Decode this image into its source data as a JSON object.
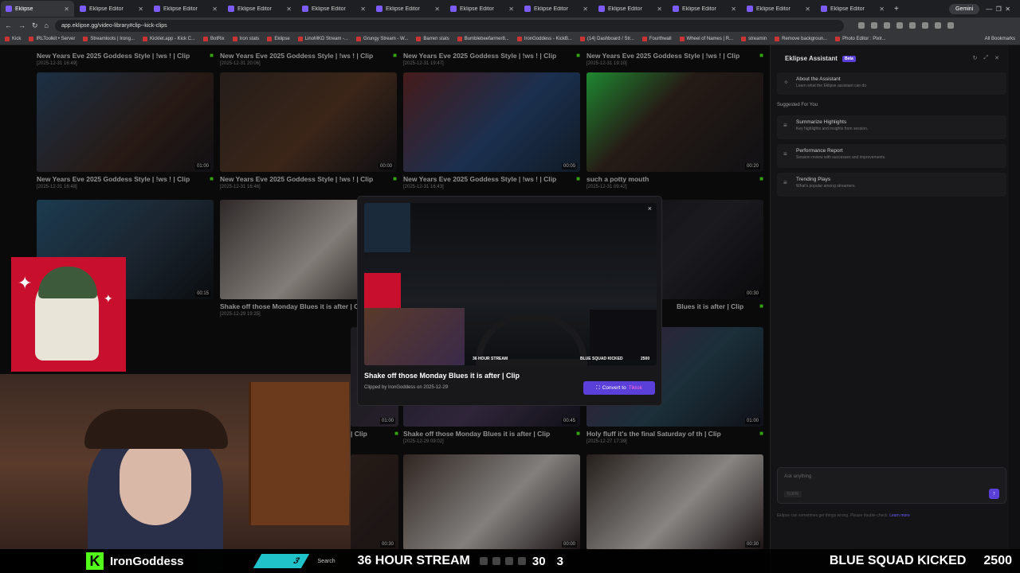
{
  "browser": {
    "tabs": [
      {
        "label": "Eklipse"
      },
      {
        "label": "Eklipse Editor"
      },
      {
        "label": "Eklipse Editor"
      },
      {
        "label": "Eklipse Editor"
      },
      {
        "label": "Eklipse Editor"
      },
      {
        "label": "Eklipse Editor"
      },
      {
        "label": "Eklipse Editor"
      },
      {
        "label": "Eklipse Editor"
      },
      {
        "label": "Eklipse Editor"
      },
      {
        "label": "Eklipse Editor"
      },
      {
        "label": "Eklipse Editor"
      },
      {
        "label": "Eklipse Editor"
      }
    ],
    "new_tab": "+",
    "gemini_label": "Gemini",
    "url": "app.eklipse.gg/video-library#clip--kick-clips",
    "bookmarks": [
      "Kick",
      "IRLToolkit • Server",
      "Streamloots | Irong...",
      "Kicklet.app - Kick C...",
      "BotRix",
      "Iron stats",
      "Eklipse",
      "LinoMKD Stream -...",
      "Grungy Stream - W...",
      "Barren stats",
      "Bumblebeefarmer8...",
      "IronGoddess - KickB...",
      "(14) Dashboard / Str...",
      "Fourthwall",
      "Wheel of Names | R...",
      "streamin",
      "Remove backgroun...",
      "Photo Editor : Pixlr..."
    ],
    "all_bookmarks": "All Bookmarks"
  },
  "clips": {
    "row1_titles": [
      {
        "title": "New Years Eve 2025 Goddess Style | !ws ! | Clip",
        "date": "[2025-12-31 16:49]"
      },
      {
        "title": "New Years Eve 2025 Goddess Style | !ws ! | Clip",
        "date": "[2025-12-31 20:06]"
      },
      {
        "title": "New Years Eve 2025 Goddess Style | !ws ! | Clip",
        "date": "[2025-12-31 19:47]"
      },
      {
        "title": "New Years Eve 2025 Goddess Style | !ws ! | Clip",
        "date": "[2025-12-31 19:10]"
      }
    ],
    "row2": [
      {
        "title": "New Years Eve 2025 Goddess Style | !ws ! | Clip",
        "date": "[2025-12-31 16:48]",
        "duration": "01:00"
      },
      {
        "title": "New Years Eve 2025 Goddess Style | !ws ! | Clip",
        "date": "[2025-12-31 16:46]",
        "duration": "00:00"
      },
      {
        "title": "New Years Eve 2025 Goddess Style | !ws ! | Clip",
        "date": "[2025-12-31 16:43]",
        "duration": "00:00"
      },
      {
        "title": "such a potty mouth",
        "date": "[2025-12-31 09:42]",
        "duration": "00:20"
      }
    ],
    "row3": [
      {
        "title": "",
        "date": "",
        "duration": "00:15"
      },
      {
        "title": "Shake off those Monday Blues it is after | C",
        "date": "[2025-12-29 19:25]",
        "duration": ""
      },
      {
        "title": "",
        "date": "",
        "duration": ""
      },
      {
        "title": "Blues it is after | Clip",
        "date": "",
        "duration": "00:30"
      }
    ],
    "row4": [
      {
        "title": "| Clip",
        "date": "",
        "duration": "01:00"
      },
      {
        "title": "Shake off those Monday Blues it is after | Clip",
        "date": "[2025-12-29 09:02]",
        "duration": "00:45"
      },
      {
        "title": "Holy fluff it's the final Saturday of th | Clip",
        "date": "[2025-12-27 17:39]",
        "duration": "01:00"
      }
    ],
    "row5_durations": [
      "00:30",
      "00:00",
      "00:30"
    ]
  },
  "modal": {
    "close": "×",
    "title": "Shake off those Monday Blues it is after | Clip",
    "clipped_by": "Clipped by IronGoddess on 2025-12-29",
    "convert_label": "Convert to",
    "convert_target": "Tiktok",
    "overlay_stream": "36 HOUR STREAM",
    "overlay_blue": "BLUE SQUAD KICKED",
    "overlay_num": "2500"
  },
  "assistant": {
    "title": "Eklipse Assistant",
    "badge": "Beta",
    "about_title": "About the Assistant",
    "about_sub": "Learn what the Eklipse assistant can do",
    "suggested": "Suggested For You",
    "items": [
      {
        "title": "Summarize Highlights",
        "sub": "Key highlights and insights from session."
      },
      {
        "title": "Performance Report",
        "sub": "Session review with successes and improvements."
      },
      {
        "title": "Trending Plays",
        "sub": "What's popular among streamers."
      }
    ],
    "ask_placeholder": "Ask anything",
    "credits": "0.00%",
    "disclaimer": "Eklipse can sometimes get things wrong. Please double-check.",
    "learn_more": "Learn more"
  },
  "stream_overlay": {
    "username": "IronGoddess",
    "kick_logo": "K",
    "teal_count": "3",
    "search": "Search",
    "hour_stream": "36 HOUR STREAM",
    "count_30": "30",
    "count_3": "3",
    "blue_squad": "BLUE SQUAD KICKED",
    "goal": "2500"
  },
  "colors": {
    "accent": "#5b3fd9",
    "kick_green": "#53fc18",
    "teal": "#20c3c9",
    "logo_red": "#c8102e"
  }
}
